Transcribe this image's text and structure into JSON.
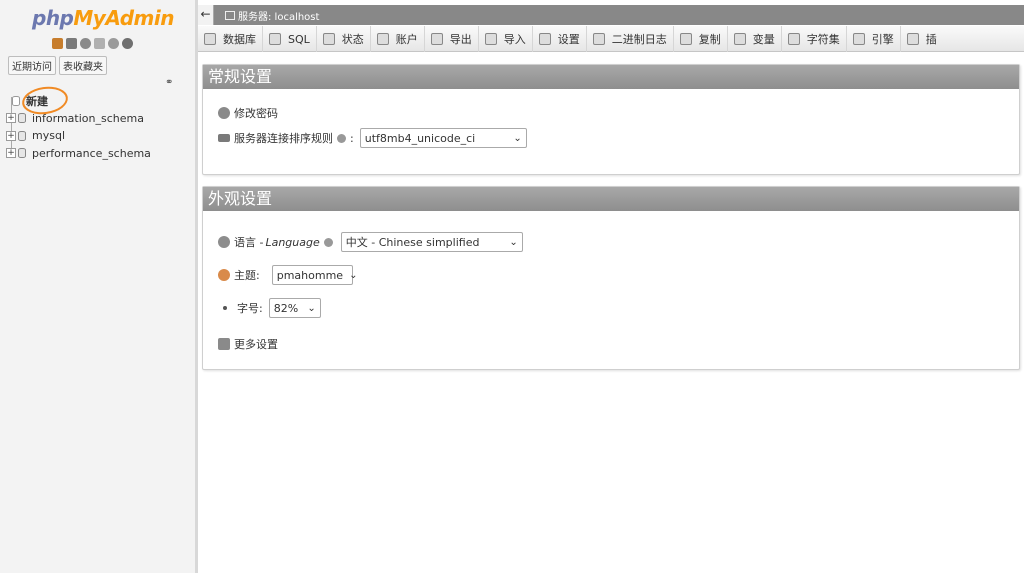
{
  "nav": {
    "logo": {
      "php": "php",
      "my": "My",
      "admin": "Admin"
    },
    "quick_links": [
      "近期访问",
      "表收藏夹"
    ],
    "new_label": "新建",
    "databases": [
      "information_schema",
      "mysql",
      "performance_schema"
    ]
  },
  "topbar": {
    "back_glyph": "←",
    "server": "服务器: localhost"
  },
  "menu": {
    "items": [
      "数据库",
      "SQL",
      "状态",
      "账户",
      "导出",
      "导入",
      "设置",
      "二进制日志",
      "复制",
      "变量",
      "字符集",
      "引擎",
      "插"
    ]
  },
  "general": {
    "title": "常规设置",
    "change_password": "修改密码",
    "collation_label": "服务器连接排序规则",
    "collation_colon": ":",
    "collation_value": "utf8mb4_unicode_ci"
  },
  "appearance": {
    "title": "外观设置",
    "language_label": "语言 - ",
    "language_italic": "Language",
    "language_value": "中文 - Chinese simplified",
    "theme_label": "主题:",
    "theme_value": "pmahomme",
    "font_label": "字号:",
    "font_value": "82%",
    "more_settings": "更多设置"
  },
  "colors": {
    "accent_orange": "#f08a24",
    "panel_header": "#999999",
    "logo_blue": "#6c78af",
    "logo_orange": "#f89c0e"
  }
}
